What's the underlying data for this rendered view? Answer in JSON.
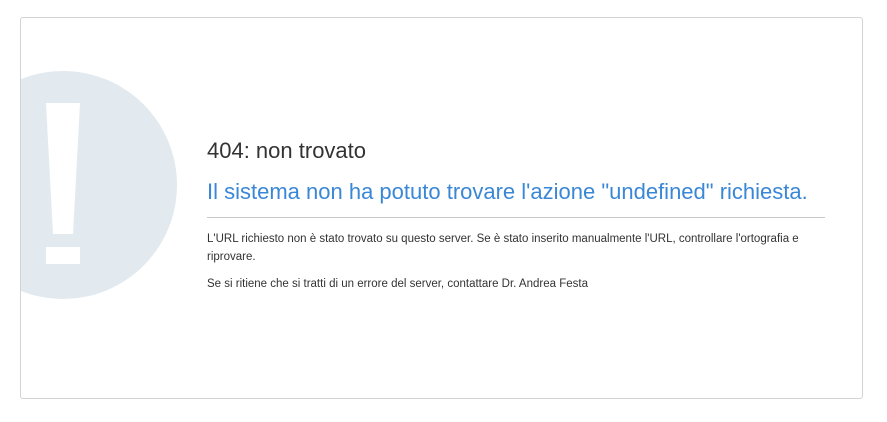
{
  "error": {
    "status": "404: non trovato",
    "headline": "Il sistema non ha potuto trovare l'azione \"undefined\" richiesta.",
    "message": "L'URL richiesto non è stato trovato su questo server. Se è stato inserito manualmente l'URL, controllare l'ortografia e riprovare.",
    "contact": "Se si ritiene che si tratti di un errore del server, contattare Dr. Andrea Festa"
  },
  "icon": {
    "name": "exclamation-icon"
  },
  "colors": {
    "headline": "#3a87d6",
    "icon_circle": "#e3eaef",
    "icon_mark": "#ffffff",
    "text": "#333333",
    "border": "#d3d3d3"
  }
}
